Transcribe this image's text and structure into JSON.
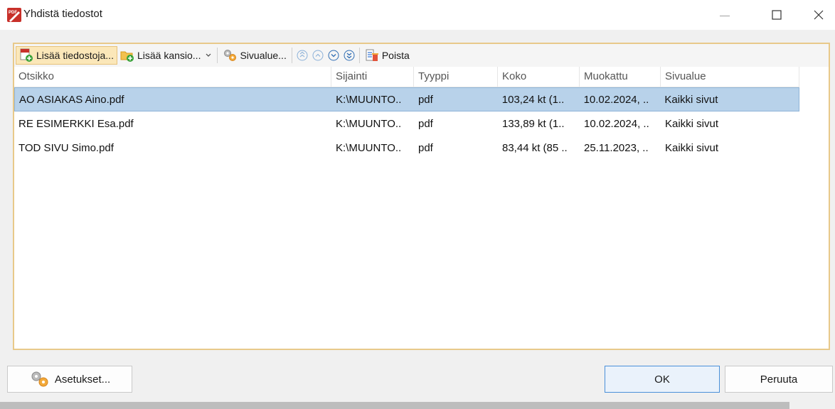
{
  "window": {
    "title": "Yhdistä tiedostot",
    "minimize_glyph": "—",
    "maximize_glyph": "☐",
    "close_glyph": "✕"
  },
  "toolbar": {
    "add_files_label": "Lisää tiedostoja...",
    "add_folder_label": "Lisää kansio...",
    "page_range_label": "Sivualue...",
    "remove_label": "Poista"
  },
  "table": {
    "columns": [
      "Otsikko",
      "Sijainti",
      "Tyyppi",
      "Koko",
      "Muokattu",
      "Sivualue"
    ],
    "rows": [
      [
        "AO ASIAKAS Aino.pdf",
        "K:\\MUUNTO..",
        "pdf",
        "103,24 kt (1..",
        "10.02.2024, ..",
        "Kaikki sivut"
      ],
      [
        "RE ESIMERKKI Esa.pdf",
        "K:\\MUUNTO..",
        "pdf",
        "133,89 kt (1..",
        "10.02.2024, ..",
        "Kaikki sivut"
      ],
      [
        "TOD SIVU Simo.pdf",
        "K:\\MUUNTO..",
        "pdf",
        "83,44 kt (85 ..",
        "25.11.2023, ..",
        "Kaikki sivut"
      ]
    ],
    "selected_row": 0
  },
  "buttons": {
    "settings_label": "Asetukset...",
    "ok_label": "OK",
    "cancel_label": "Peruuta"
  },
  "colors": {
    "accent_border": "#e8c98a",
    "selection": "#b8d2ea",
    "default_button_border": "#4a90d9"
  }
}
